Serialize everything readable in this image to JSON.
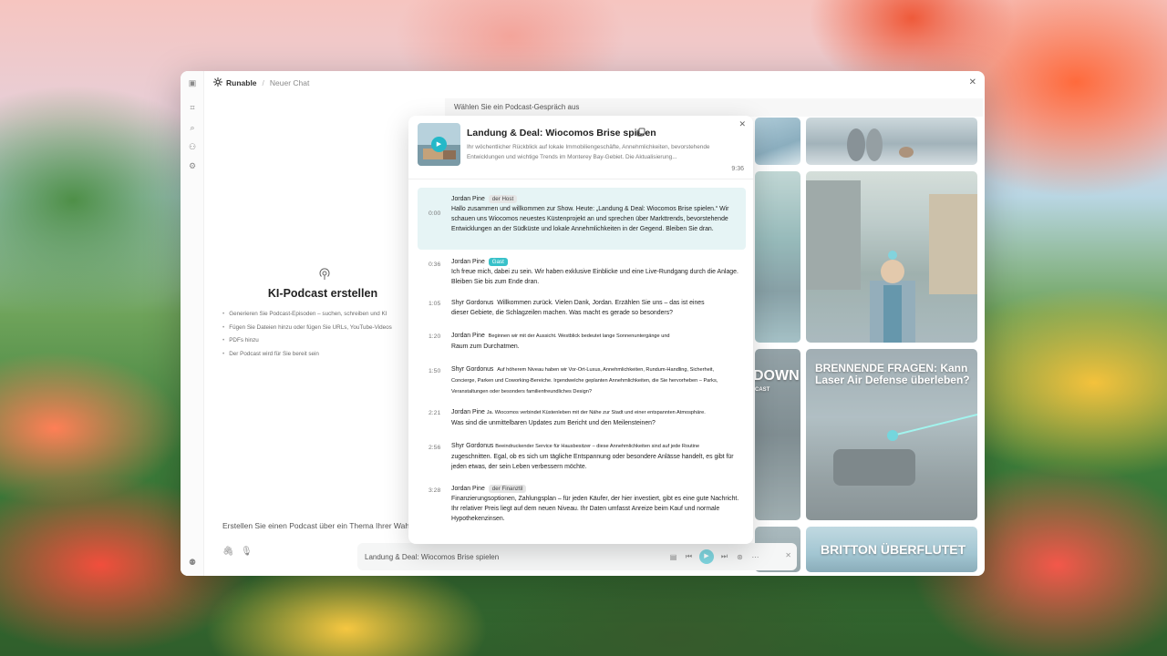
{
  "app": {
    "brand": "Runable",
    "breadcrumb": "Neuer Chat"
  },
  "empty_state": {
    "title": "KI-Podcast erstellen",
    "bullets": [
      "Generieren Sie Podcast-Episoden – suchen, schreiben und KI",
      "Fügen Sie Dateien hinzu oder fügen Sie URLs, YouTube-Videos",
      "PDFs hinzu",
      "Der Podcast wird für Sie bereit sein"
    ]
  },
  "prompt": {
    "placeholder": "Erstellen Sie einen Podcast über ein Thema Ihrer Wahl ..."
  },
  "picker": {
    "header": "Wählen Sie ein Podcast-Gespräch aus"
  },
  "gallery": {
    "tile_titles": [
      "BRENNENDE FRAGEN: Kann Laser Air Defense überleben?",
      "BRITTON ÜBERFLUTET",
      "DOWN",
      "CAST"
    ]
  },
  "modal": {
    "title": "Landung & Deal: Wiocomos Brise spielen",
    "description": "Ihr wöchentlicher Rückblick auf lokale Immobiliengeschäfte, Annehmlichkeiten, bevorstehende Entwicklungen und wichtige Trends im Monterey Bay-Gebiet. Die Aktualisierung...",
    "duration": "9:36",
    "transcript": [
      {
        "time": "0:00",
        "speaker": "Jordan Pine",
        "tag": "der Host",
        "text": "Hallo zusammen und willkommen zur Show. Heute: „Landung & Deal: Wiocomos Brise spielen.“ Wir schauen uns Wiocomos neuestes Küstenprojekt an und sprechen über Markttrends, bevorstehende Entwicklungen an der Südküste und lokale Annehmlichkeiten in der Gegend. Bleiben Sie dran."
      },
      {
        "time": "0:36",
        "speaker": "Jordan Pine",
        "tag": "Gast",
        "text": "Ich freue mich, dabei zu sein. Wir haben exklusive Einblicke und eine Live-Rundgang durch die Anlage. Bleiben Sie bis zum Ende dran."
      },
      {
        "time": "1:05",
        "speaker": "Shyr Gordonus",
        "lead": "Willkommen zurück. Vielen Dank, Jordan. Erzählen Sie uns – das ist eines",
        "text": "dieser Gebiete, die Schlagzeilen machen. Was macht es gerade so besonders?"
      },
      {
        "time": "1:20",
        "speaker": "Jordan Pine",
        "lead": "Beginnen wir mit der Aussicht. Westblick bedeutet lange Sonnenuntergänge und",
        "text": "Raum zum Durchatmen."
      },
      {
        "time": "1:50",
        "speaker": "Shyr Gordonus",
        "lead": "Auf höherem Niveau haben wir Vor-Ort-Luxus, Annehmlichkeiten, Rundum-Handling, Sicherheit,",
        "text": "Concierge, Parken und Coworking-Bereiche. Irgendwelche geplanten Annehmlichkeiten, die Sie hervorheben – Parks, Veranstaltungen oder besonders familienfreundliches Design?"
      },
      {
        "time": "2:21",
        "speaker": "Jordan Pine",
        "lead": "Ja. Wiocomos verbindet Küstenleben mit der Nähe zur Stadt und einer entspannten Atmosphäre.",
        "text": "Was sind die unmittelbaren Updates zum Bericht und den Meilensteinen?"
      },
      {
        "time": "2:56",
        "speaker": "Shyr Gordonus",
        "lead": "Beeindruckender Service für Hausbesitzer – diese Annehmlichkeiten sind auf jede Routine",
        "text": "zugeschnitten. Egal, ob es sich um tägliche Entspannung oder besondere Anlässe handelt, es gibt für jeden etwas, der sein Leben verbessern möchte."
      },
      {
        "time": "3:28",
        "speaker": "Jordan Pine",
        "tag": "der Finanztil",
        "text": "Finanzierungsoptionen, Zahlungsplan – für jeden Käufer, der hier investiert, gibt es eine gute Nachricht. Ihr relativer Preis liegt auf dem neuen Niveau. Ihr Daten umfasst Anreize beim Kauf und normale Hypothekenzinsen."
      }
    ]
  },
  "player": {
    "title": "Landung & Deal: Wiocomos Brise spielen"
  },
  "colors": {
    "accent": "#38c1c9",
    "active_row": "#e6f4f5"
  }
}
